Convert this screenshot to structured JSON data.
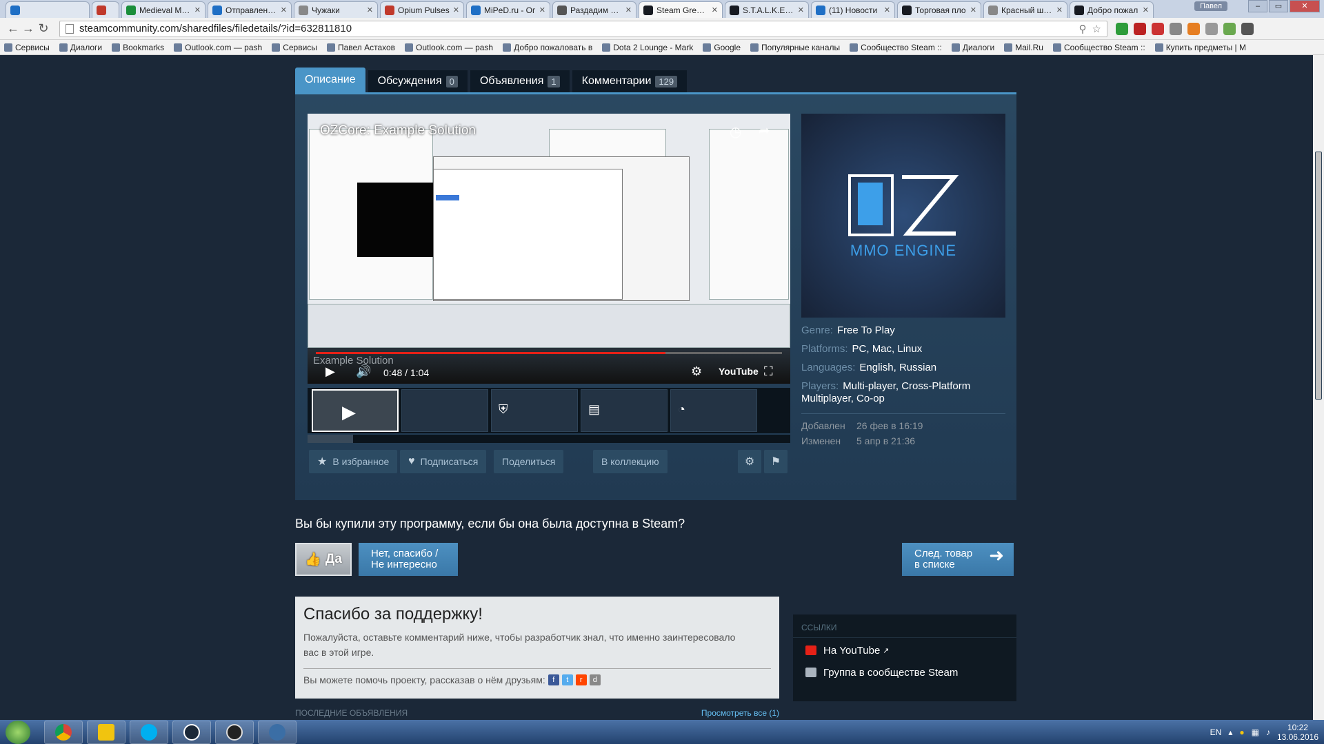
{
  "browser": {
    "tabs": [
      {
        "label": "",
        "color": "#1f6fc5",
        "active": false
      },
      {
        "label": "",
        "color": "#c0392b",
        "active": false
      },
      {
        "label": "Medieval Merc",
        "color": "#1a8e3a",
        "active": false
      },
      {
        "label": "Отправленные",
        "color": "#1f6fc5",
        "active": false
      },
      {
        "label": "Чужаки",
        "color": "#888888",
        "active": false
      },
      {
        "label": "Opium Pulses",
        "color": "#c0392b",
        "active": false
      },
      {
        "label": "MiPeD.ru - Ог",
        "color": "#1f6fc5",
        "active": false
      },
      {
        "label": "Раздадим про",
        "color": "#555555",
        "active": false
      },
      {
        "label": "Steam Greenli",
        "color": "#171a21",
        "active": true
      },
      {
        "label": "S.T.A.L.K.E.R.: С",
        "color": "#171a21",
        "active": false
      },
      {
        "label": "(11) Новости",
        "color": "#1f6fc5",
        "active": false
      },
      {
        "label": "Торговая пло",
        "color": "#171a21",
        "active": false
      },
      {
        "label": "Красный штат",
        "color": "#888888",
        "active": false
      },
      {
        "label": "Добро пожал",
        "color": "#171a21",
        "active": false
      }
    ],
    "user": "Павел",
    "url": "steamcommunity.com/sharedfiles/filedetails/?id=632811810",
    "bookmarks": [
      "Сервисы",
      "Диалоги",
      "Bookmarks",
      "Outlook.com — pash",
      "Сервисы",
      "Павел Астахов",
      "Outlook.com — pash",
      "Добро пожаловать в",
      "Dota 2 Lounge - Mark",
      "Google",
      "Популярные каналы",
      "Сообщество Steam ::",
      "Диалоги",
      "Mail.Ru",
      "Сообщество Steam ::",
      "Купить предметы | M"
    ]
  },
  "tabs": {
    "description": "Описание",
    "discussions": "Обсуждения",
    "discussions_count": "0",
    "announcements": "Объявления",
    "announcements_count": "1",
    "comments": "Комментарии",
    "comments_count": "129"
  },
  "video": {
    "title": "OZCore: Example Solution",
    "subtitle": "Example Solution",
    "time": "0:48 / 1:04",
    "progress_fraction": 0.75
  },
  "logo": {
    "text": "MMO ENGINE",
    "accent": "#3d9fe9"
  },
  "meta": {
    "genre_label": "Genre:",
    "genre_value": "Free To Play",
    "platforms_label": "Platforms:",
    "platforms_value": "PC, Mac, Linux",
    "languages_label": "Languages:",
    "languages_value": "English, Russian",
    "players_label": "Players:",
    "players_value": "Multi-player, Cross-Platform Multiplayer, Co-op",
    "added_label": "Добавлен",
    "added_value": "26 фев в 16:19",
    "updated_label": "Изменен",
    "updated_value": "5 апр в 21:36"
  },
  "actions": {
    "favorite": "В избранное",
    "follow": "Подписаться",
    "share": "Поделиться",
    "collection": "В коллекцию"
  },
  "vote": {
    "question": "Вы бы купили эту программу, если бы она была доступна в Steam?",
    "yes": "Да",
    "no_line1": "Нет, спасибо /",
    "no_line2": "Не интересно",
    "next_line1": "След. товар",
    "next_line2": "в списке"
  },
  "thanks": {
    "title": "Спасибо за поддержку!",
    "body": "Пожалуйста, оставьте комментарий ниже, чтобы разработчик знал, что именно заинтересовало вас в этой игре.",
    "share": "Вы можете помочь проекту, рассказав о нём друзьям:"
  },
  "recent": {
    "label": "ПОСЛЕДНИЕ ОБЪЯВЛЕНИЯ",
    "view_all": "Просмотреть все (1)"
  },
  "links": {
    "head": "ССЫЛКИ",
    "youtube": "На YouTube",
    "group": "Группа в сообществе Steam"
  },
  "taskbar": {
    "lang": "EN",
    "time": "10:22",
    "date": "13.06.2016"
  }
}
